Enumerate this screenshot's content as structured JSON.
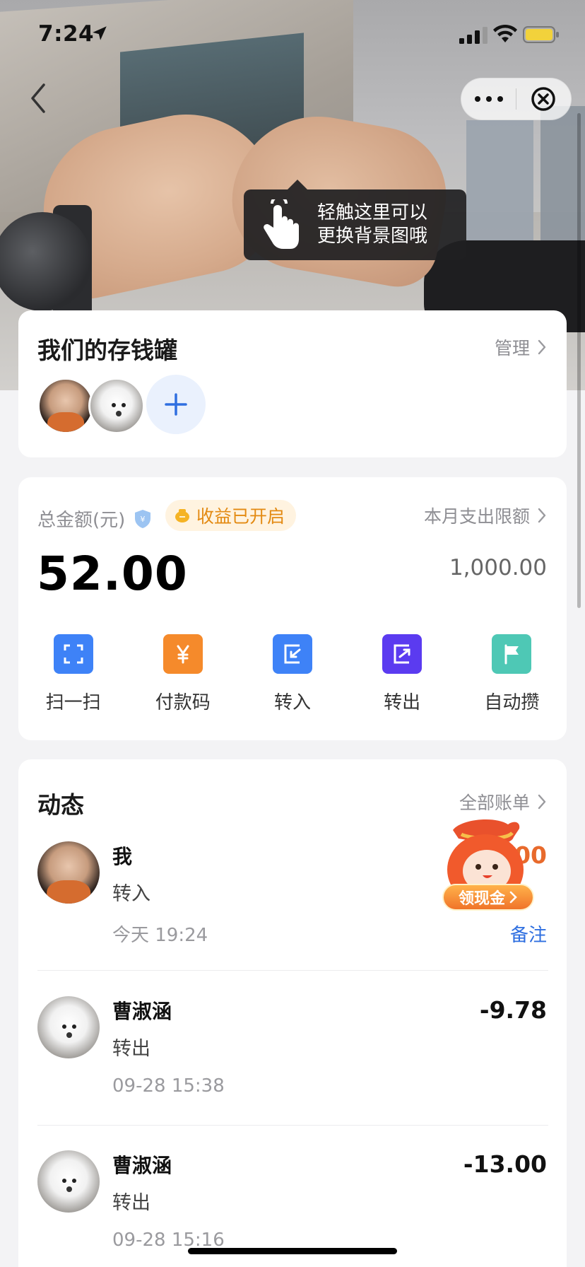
{
  "status_bar": {
    "time": "7:24"
  },
  "tooltip": {
    "line1": "轻触这里可以",
    "line2": "更换背景图哦"
  },
  "piggy_card": {
    "title": "我们的存钱罐",
    "manage_label": "管理"
  },
  "balance_card": {
    "total_label": "总金额(元)",
    "earnings_badge": "收益已开启",
    "limit_label": "本月支出限额",
    "amount": "52.00",
    "limit_amount": "1,000.00",
    "actions": [
      {
        "label": "扫一扫",
        "icon": "scan-icon",
        "color": "#3e82f7"
      },
      {
        "label": "付款码",
        "icon": "payment-code-icon",
        "color": "#f58a2b"
      },
      {
        "label": "转入",
        "icon": "transfer-in-icon",
        "color": "#3e82f7"
      },
      {
        "label": "转出",
        "icon": "transfer-out-icon",
        "color": "#5b3bf0"
      },
      {
        "label": "自动攒",
        "icon": "auto-save-icon",
        "color": "#4ec8b5"
      }
    ]
  },
  "activity": {
    "title": "动态",
    "all_bills_label": "全部账单",
    "records": [
      {
        "name": "我",
        "type": "转入",
        "time": "今天 19:24",
        "amount": "00",
        "note": "备注"
      },
      {
        "name": "曹淑涵",
        "type": "转出",
        "time": "09-28 15:38",
        "amount": "-9.78"
      },
      {
        "name": "曹淑涵",
        "type": "转出",
        "time": "09-28 15:16",
        "amount": "-13.00"
      }
    ]
  },
  "promo": {
    "label": "领现金"
  },
  "colors": {
    "accent": "#2f6fe0",
    "orange": "#e38a12",
    "background": "#f3f3f5"
  }
}
